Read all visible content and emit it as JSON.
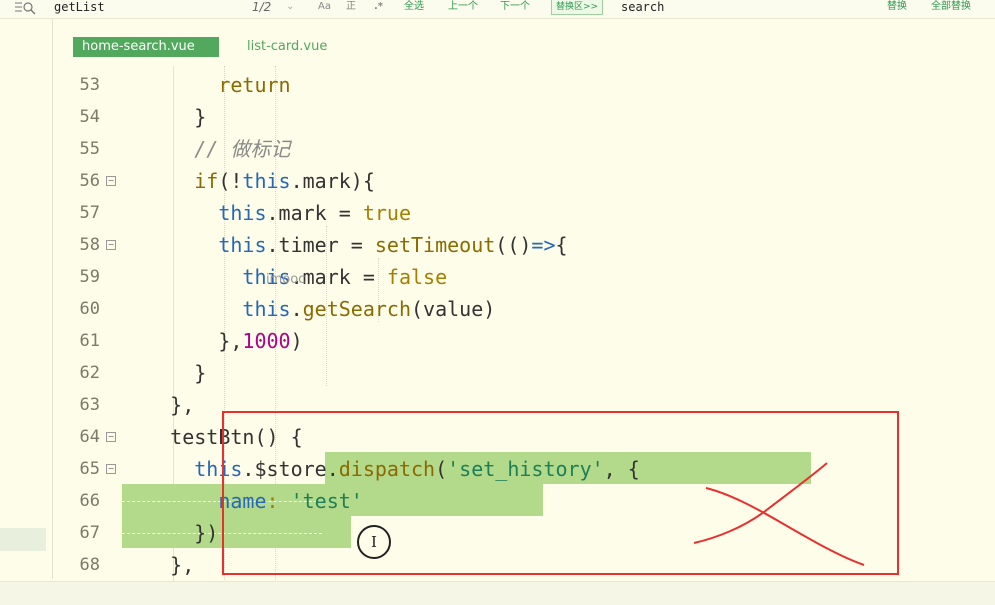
{
  "findbar": {
    "find_value": "getList",
    "match_count": "1/2",
    "case_label": "Aa",
    "word_label": "正",
    "regex_label": ".*",
    "select_all": "全选",
    "prev": "上一个",
    "next": "下一个",
    "replace_toggle": "替换区>>",
    "replace_value": "search",
    "replace": "替换",
    "replace_all": "全部替换"
  },
  "tabs": [
    {
      "label": "home-search.vue",
      "active": true
    },
    {
      "label": "list-card.vue",
      "active": false
    }
  ],
  "watermark": "imooc",
  "cursor_glyph": "I",
  "editor": {
    "lines": [
      {
        "num": "53",
        "fold": false,
        "tokens": [
          {
            "t": "        ",
            "c": "pl"
          },
          {
            "t": "return",
            "c": "ctl"
          }
        ]
      },
      {
        "num": "54",
        "fold": false,
        "tokens": [
          {
            "t": "      }",
            "c": "pl"
          }
        ]
      },
      {
        "num": "55",
        "fold": false,
        "tokens": [
          {
            "t": "      // 做标记",
            "c": "cm"
          }
        ]
      },
      {
        "num": "56",
        "fold": true,
        "tokens": [
          {
            "t": "      if",
            "c": "ctl"
          },
          {
            "t": "(",
            "c": "pl"
          },
          {
            "t": "!",
            "c": "pl"
          },
          {
            "t": "this",
            "c": "kw"
          },
          {
            "t": ".mark){",
            "c": "pl"
          }
        ]
      },
      {
        "num": "57",
        "fold": false,
        "tokens": [
          {
            "t": "        ",
            "c": "pl"
          },
          {
            "t": "this",
            "c": "kw"
          },
          {
            "t": ".mark = ",
            "c": "pl"
          },
          {
            "t": "true",
            "c": "bool"
          }
        ]
      },
      {
        "num": "58",
        "fold": true,
        "tokens": [
          {
            "t": "        ",
            "c": "pl"
          },
          {
            "t": "this",
            "c": "kw"
          },
          {
            "t": ".timer = ",
            "c": "pl"
          },
          {
            "t": "setTimeout",
            "c": "fn"
          },
          {
            "t": "(()",
            "c": "pl"
          },
          {
            "t": "=>",
            "c": "kw"
          },
          {
            "t": "{",
            "c": "pl"
          }
        ]
      },
      {
        "num": "59",
        "fold": false,
        "tokens": [
          {
            "t": "          ",
            "c": "pl"
          },
          {
            "t": "this",
            "c": "kw"
          },
          {
            "t": ".mark = ",
            "c": "pl"
          },
          {
            "t": "false",
            "c": "bool"
          }
        ]
      },
      {
        "num": "60",
        "fold": false,
        "tokens": [
          {
            "t": "          ",
            "c": "pl"
          },
          {
            "t": "this",
            "c": "kw"
          },
          {
            "t": ".",
            "c": "pl"
          },
          {
            "t": "getSearch",
            "c": "fn"
          },
          {
            "t": "(value)",
            "c": "pl"
          }
        ]
      },
      {
        "num": "61",
        "fold": false,
        "tokens": [
          {
            "t": "        },",
            "c": "pl"
          },
          {
            "t": "1000",
            "c": "num"
          },
          {
            "t": ")",
            "c": "pl"
          }
        ]
      },
      {
        "num": "62",
        "fold": false,
        "tokens": [
          {
            "t": "      }",
            "c": "pl"
          }
        ]
      },
      {
        "num": "63",
        "fold": false,
        "tokens": [
          {
            "t": "    },",
            "c": "pl"
          }
        ]
      },
      {
        "num": "64",
        "fold": true,
        "tokens": [
          {
            "t": "    testBtn() {",
            "c": "pl"
          }
        ]
      },
      {
        "num": "65",
        "fold": true,
        "tokens": [
          {
            "t": "      ",
            "c": "pl"
          },
          {
            "t": "this",
            "c": "kw"
          },
          {
            "t": ".$store.",
            "c": "pl"
          },
          {
            "t": "dispatch",
            "c": "fn"
          },
          {
            "t": "(",
            "c": "pl"
          },
          {
            "t": "'set_history'",
            "c": "str"
          },
          {
            "t": ", {",
            "c": "pl"
          }
        ]
      },
      {
        "num": "66",
        "fold": false,
        "tokens": [
          {
            "t": "        ",
            "c": "pl"
          },
          {
            "t": "name",
            "c": "kw"
          },
          {
            "t": ": ",
            "c": "bool"
          },
          {
            "t": "'test'",
            "c": "str"
          }
        ]
      },
      {
        "num": "67",
        "fold": false,
        "tokens": [
          {
            "t": "      })",
            "c": "pl"
          }
        ]
      },
      {
        "num": "68",
        "fold": false,
        "tokens": [
          {
            "t": "    },",
            "c": "pl"
          }
        ]
      }
    ]
  },
  "colors": {
    "accent": "#52a85c",
    "annotation": "#e8302e",
    "selection": "#b3d98b",
    "background": "#fdfde9"
  }
}
